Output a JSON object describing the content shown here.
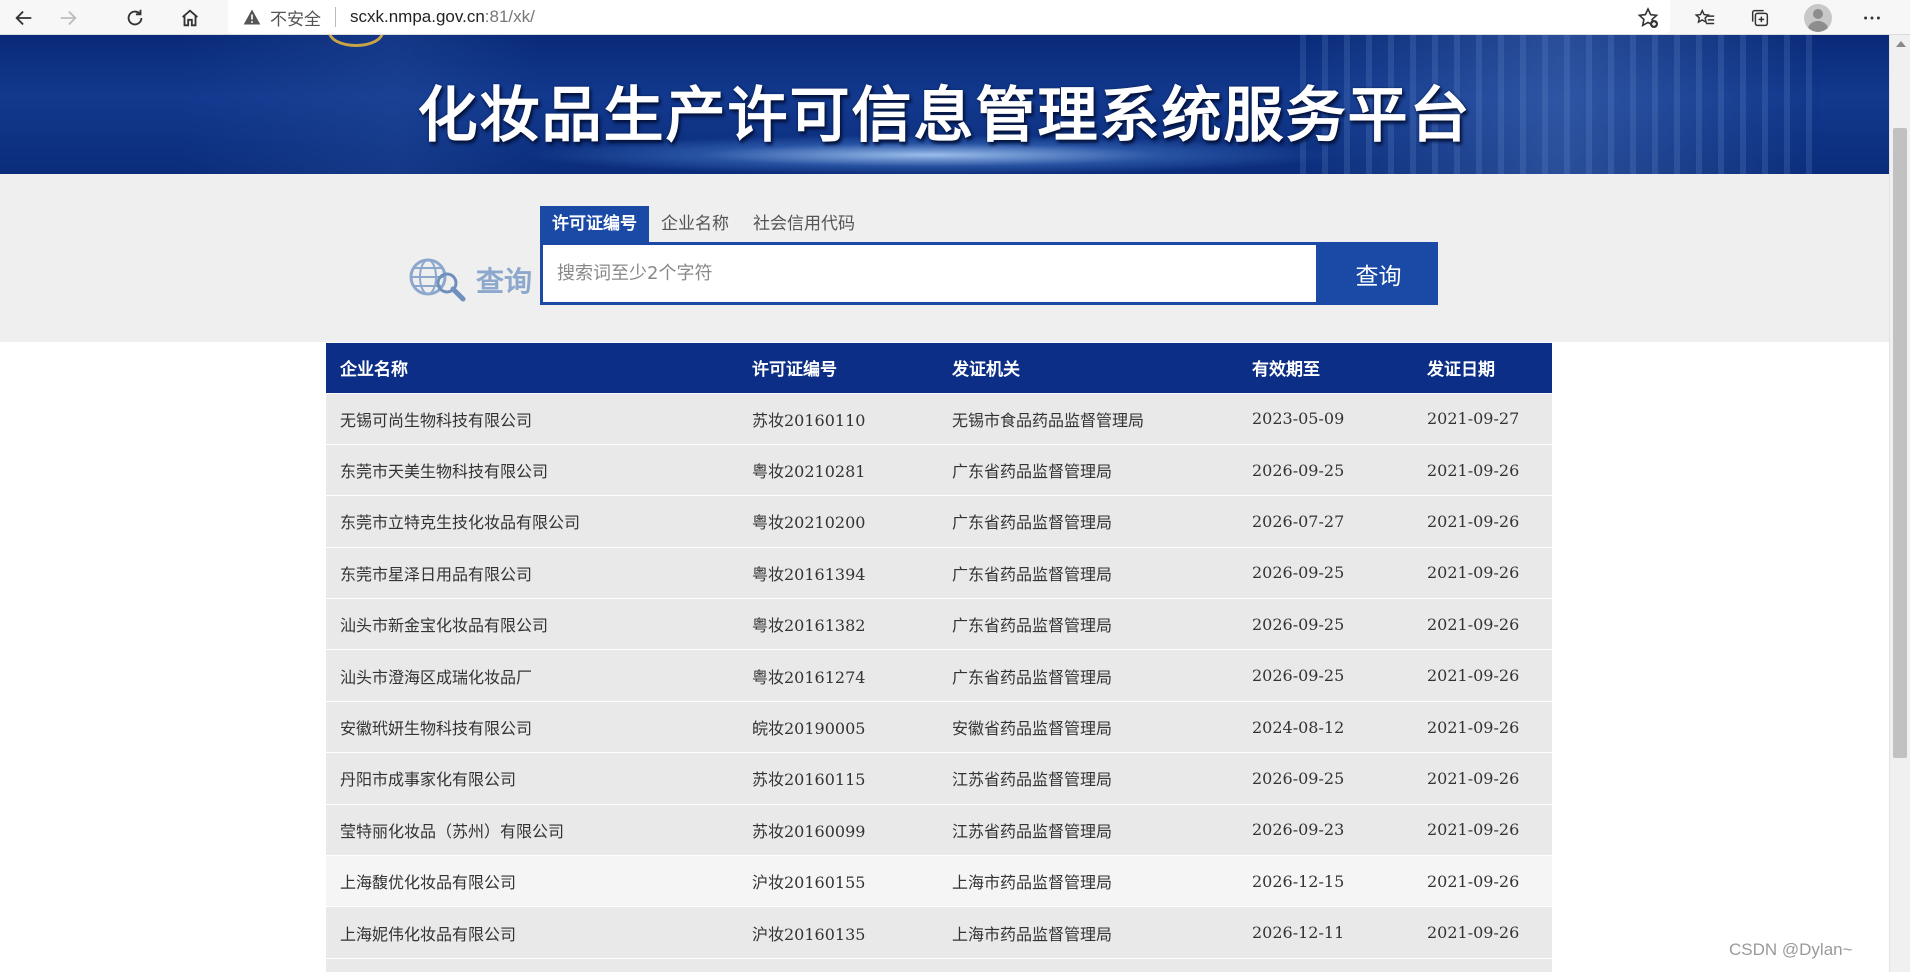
{
  "browser": {
    "security_label": "不安全",
    "url_host": "scxk.nmpa.gov.cn",
    "url_rest": ":81/xk/",
    "icons": [
      "back-icon",
      "forward-icon",
      "refresh-icon",
      "home-icon",
      "warning-icon",
      "add-favorite-icon",
      "favorites-icon",
      "collections-icon",
      "profile-icon",
      "more-icon"
    ]
  },
  "banner": {
    "title": "化妆品生产许可信息管理系统服务平台"
  },
  "search": {
    "logo_text": "查询",
    "tabs": [
      {
        "label": "许可证编号",
        "active": true
      },
      {
        "label": "企业名称",
        "active": false
      },
      {
        "label": "社会信用代码",
        "active": false
      }
    ],
    "placeholder": "搜索词至少2个字符",
    "value": "",
    "button_label": "查询"
  },
  "table": {
    "headers": [
      "企业名称",
      "许可证编号",
      "发证机关",
      "有效期至",
      "发证日期"
    ],
    "rows": [
      [
        "无锡可尚生物科技有限公司",
        "苏妆20160110",
        "无锡市食品药品监督管理局",
        "2023-05-09",
        "2021-09-27"
      ],
      [
        "东莞市天美生物科技有限公司",
        "粤妆20210281",
        "广东省药品监督管理局",
        "2026-09-25",
        "2021-09-26"
      ],
      [
        "东莞市立特克生技化妆品有限公司",
        "粤妆20210200",
        "广东省药品监督管理局",
        "2026-07-27",
        "2021-09-26"
      ],
      [
        "东莞市星泽日用品有限公司",
        "粤妆20161394",
        "广东省药品监督管理局",
        "2026-09-25",
        "2021-09-26"
      ],
      [
        "汕头市新金宝化妆品有限公司",
        "粤妆20161382",
        "广东省药品监督管理局",
        "2026-09-25",
        "2021-09-26"
      ],
      [
        "汕头市澄海区成瑞化妆品厂",
        "粤妆20161274",
        "广东省药品监督管理局",
        "2026-09-25",
        "2021-09-26"
      ],
      [
        "安徽玳妍生物科技有限公司",
        "皖妆20190005",
        "安徽省药品监督管理局",
        "2024-08-12",
        "2021-09-26"
      ],
      [
        "丹阳市成事家化有限公司",
        "苏妆20160115",
        "江苏省药品监督管理局",
        "2026-09-25",
        "2021-09-26"
      ],
      [
        "莹特丽化妆品（苏州）有限公司",
        "苏妆20160099",
        "江苏省药品监督管理局",
        "2026-09-23",
        "2021-09-26"
      ],
      [
        "上海馥优化妆品有限公司",
        "沪妆20160155",
        "上海市药品监督管理局",
        "2026-12-15",
        "2021-09-26"
      ],
      [
        "上海妮伟化妆品有限公司",
        "沪妆20160135",
        "上海市药品监督管理局",
        "2026-12-11",
        "2021-09-26"
      ],
      [
        "",
        "",
        "",
        "",
        ""
      ]
    ]
  },
  "colors": {
    "primary_blue": "#1a4aa6",
    "table_header": "#0d2e86",
    "row_bg": "#e9e9e9"
  },
  "watermark": "CSDN @Dylan~"
}
